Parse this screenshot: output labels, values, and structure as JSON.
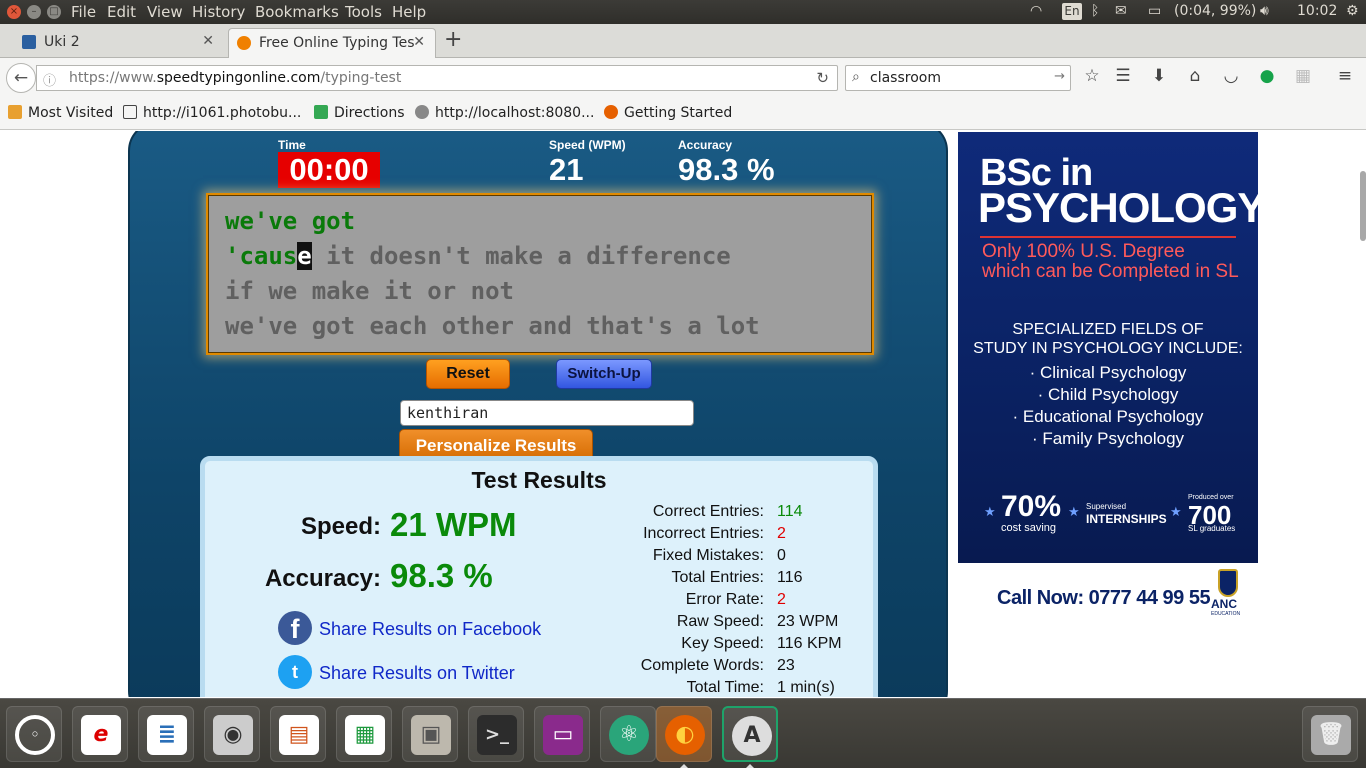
{
  "menubar": {
    "items": [
      "File",
      "Edit",
      "View",
      "History",
      "Bookmarks",
      "Tools",
      "Help"
    ],
    "keyboard_layout": "En",
    "battery": "(0:04, 99%)",
    "clock": "10:02"
  },
  "tabs": [
    {
      "title": "Uki 2",
      "active": false
    },
    {
      "title": "Free Online Typing Tes",
      "active": true
    }
  ],
  "navbar": {
    "url_prefix": "https://www.",
    "url_domain": "speedtypingonline.com",
    "url_path": "/typing-test",
    "search_value": "classroom"
  },
  "bookmarks": [
    "Most Visited",
    "http://i1061.photobu...",
    "Directions",
    "http://localhost:8080...",
    "Getting Started"
  ],
  "test": {
    "time_label": "Time",
    "time_value": "00:00",
    "speed_label": "Speed (WPM)",
    "speed_value": "21",
    "accuracy_label": "Accuracy",
    "accuracy_value": "98.3 %",
    "typing": {
      "line1_typed": "we've got",
      "line2_typed": "'caus",
      "line2_cursor": "e",
      "line2_rest": " it doesn't make a difference",
      "line3": "if we make it or not",
      "line4": "we've got each other and that's a lot"
    },
    "reset_label": "Reset",
    "switch_label": "Switch-Up",
    "name_value": "kenthiran",
    "personalize_label": "Personalize Results"
  },
  "results": {
    "title": "Test Results",
    "speed_label": "Speed:",
    "speed_value": "21 WPM",
    "accuracy_label": "Accuracy:",
    "accuracy_value": "98.3 %",
    "share_facebook": "Share Results on Facebook",
    "share_twitter": "Share Results on Twitter",
    "details": [
      {
        "label": "Correct Entries:",
        "value": "114",
        "color": "green"
      },
      {
        "label": "Incorrect Entries:",
        "value": "2",
        "color": "red"
      },
      {
        "label": "Fixed Mistakes:",
        "value": "0",
        "color": ""
      },
      {
        "label": "Total Entries:",
        "value": "116",
        "color": ""
      },
      {
        "label": "Error Rate:",
        "value": "2",
        "color": "red"
      },
      {
        "label": "Raw Speed:",
        "value": "23 WPM",
        "color": ""
      },
      {
        "label": "Key Speed:",
        "value": "116 KPM",
        "color": ""
      },
      {
        "label": "Complete Words:",
        "value": "23",
        "color": ""
      },
      {
        "label": "Total Time:",
        "value": "1 min(s)",
        "color": ""
      }
    ]
  },
  "ad": {
    "title_line1": "BSc in",
    "title_line2": "PSYCHOLOGY",
    "sub_line1": "Only 100% U.S. Degree",
    "sub_line2": "which can be Completed in SL",
    "fields_line1": "SPECIALIZED FIELDS OF",
    "fields_line2": "STUDY IN PSYCHOLOGY INCLUDE:",
    "fields": [
      "· Clinical Psychology",
      "· Child Psychology",
      "· Educational Psychology",
      "· Family Psychology"
    ],
    "stat1_big": "70%",
    "stat1_small": "cost saving",
    "stat2_small": "Supervised",
    "stat2_big": "INTERNSHIPS",
    "stat3_small": "Produced over",
    "stat3_big": "700",
    "stat3_tail": "SL graduates",
    "call": "Call Now: 0777 44 99 55",
    "brand": "ANC",
    "brand_small": "EDUCATION"
  },
  "colors": {
    "panel": "#0e4468",
    "timer_bg": "#e60000",
    "typed_text": "#0a7a0a",
    "result_value": "#0a8a0a",
    "error_value": "#e00000",
    "link": "#1028c8",
    "ad_bg": "#0b2366"
  },
  "dock_icons": [
    "ubuntu-home-icon",
    "reader-icon",
    "writer-icon",
    "camera-icon",
    "impress-icon",
    "calc-icon",
    "file-manager-icon",
    "terminal-icon",
    "app-window-icon",
    "atom-icon",
    "firefox-icon",
    "software-updater-icon",
    "trash-icon"
  ]
}
